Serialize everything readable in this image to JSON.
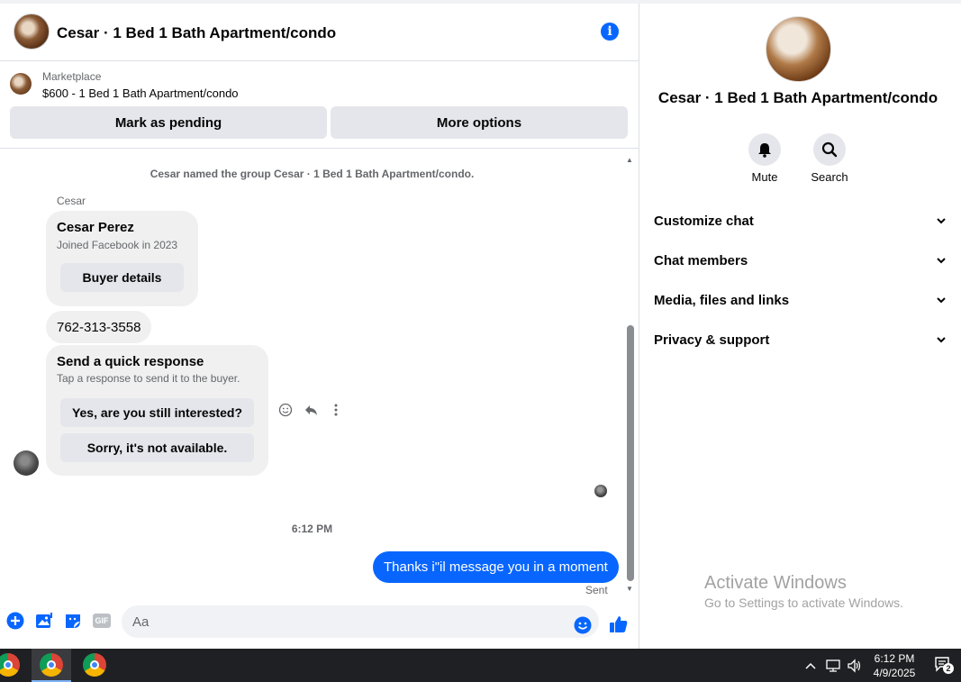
{
  "header": {
    "title": "Cesar · 1 Bed 1 Bath Apartment/condo",
    "info_icon": "info-icon"
  },
  "marketplace": {
    "label": "Marketplace",
    "listing": "$600 - 1 Bed 1 Bath Apartment/condo",
    "mark_pending": "Mark as pending",
    "more_options": "More options"
  },
  "messages": {
    "system_cut": "",
    "system_rename": "Cesar named the group Cesar · 1 Bed 1 Bath Apartment/condo.",
    "sender": "Cesar",
    "buyer_card": {
      "name": "Cesar Perez",
      "joined": "Joined Facebook in 2023",
      "button": "Buyer details"
    },
    "phone": "762-313-3558",
    "quick_response": {
      "title": "Send a quick response",
      "subtitle": "Tap a response to send it to the buyer.",
      "option1": "Yes, are you still interested?",
      "option2": "Sorry, it's not available."
    },
    "timestamp": "6:12 PM",
    "outgoing": "Thanks i\"il message you in a moment",
    "status": "Sent"
  },
  "composer": {
    "placeholder": "Aa",
    "icons": [
      "plus-icon",
      "photo-icon",
      "sticker-icon",
      "gif-icon",
      "emoji-icon",
      "thumbs-up-icon"
    ],
    "gif_label": "GIF"
  },
  "details": {
    "title": "Cesar · 1 Bed 1 Bath Apartment/condo",
    "actions": [
      {
        "label": "Mute",
        "icon": "bell-icon"
      },
      {
        "label": "Search",
        "icon": "search-icon"
      }
    ],
    "sections": [
      "Customize chat",
      "Chat members",
      "Media, files and links",
      "Privacy & support"
    ]
  },
  "watermark": {
    "line1": "Activate Windows",
    "line2": "Go to Settings to activate Windows."
  },
  "taskbar": {
    "time": "6:12 PM",
    "date": "4/9/2025",
    "notifications": "2"
  },
  "colors": {
    "accent": "#0866ff",
    "bubble_gray": "#f0f0f0",
    "button_gray": "#e4e6eb",
    "taskbar": "#1f2023"
  }
}
